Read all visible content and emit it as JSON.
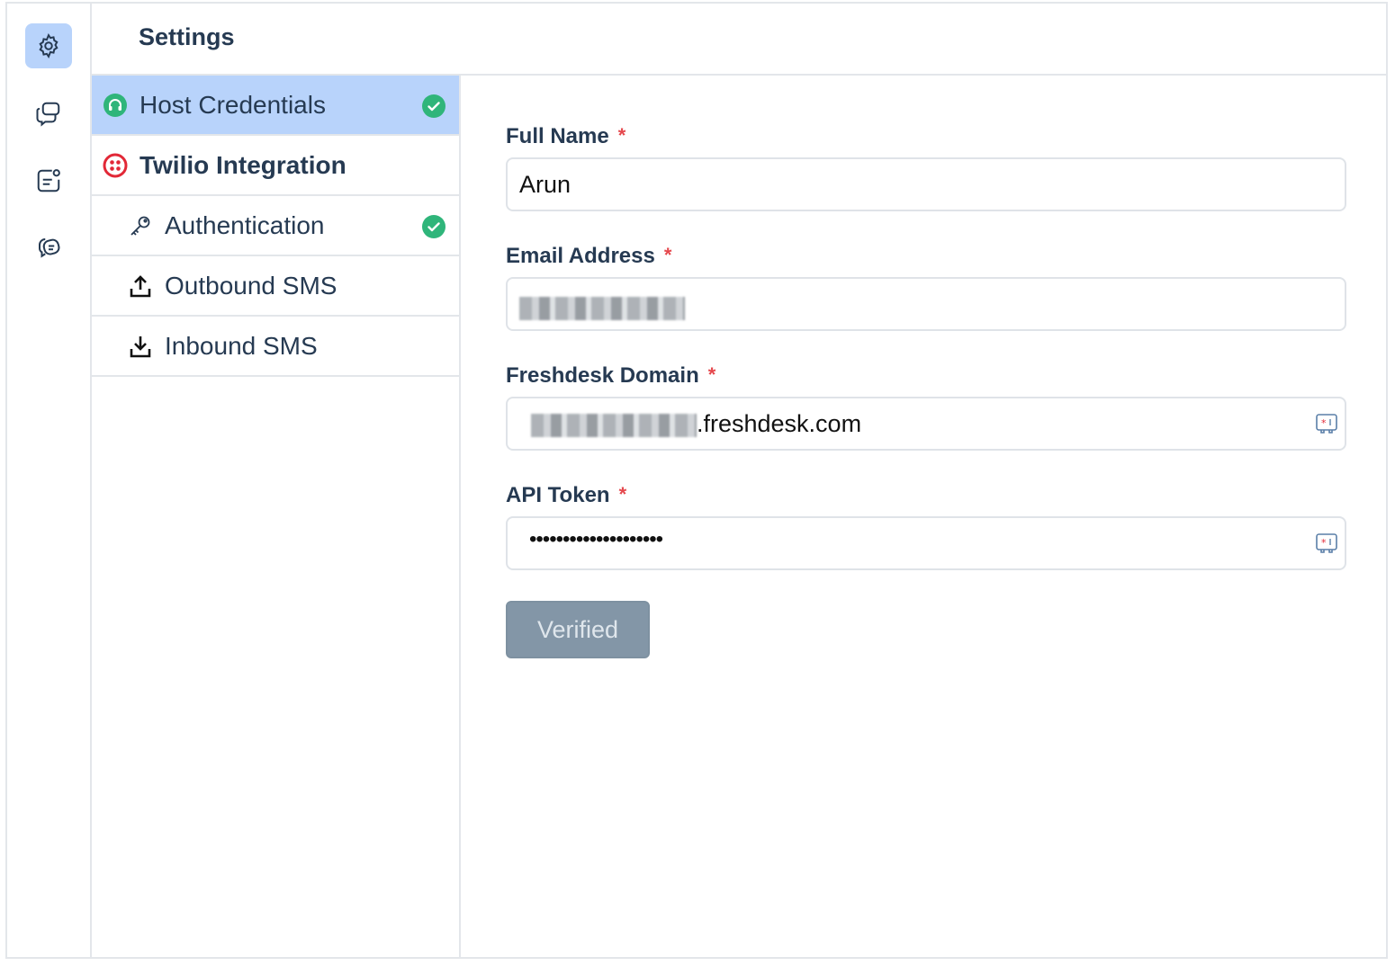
{
  "header": {
    "title": "Settings"
  },
  "rail": {
    "items": [
      {
        "icon": "gear-icon",
        "active": true
      },
      {
        "icon": "chat-bubbles-icon",
        "active": false
      },
      {
        "icon": "contact-card-icon",
        "active": false
      },
      {
        "icon": "brain-chat-icon",
        "active": false
      }
    ]
  },
  "nav": {
    "host_credentials": "Host Credentials",
    "twilio_integration": "Twilio Integration",
    "authentication": "Authentication",
    "outbound_sms": "Outbound SMS",
    "inbound_sms": "Inbound SMS"
  },
  "form": {
    "full_name": {
      "label": "Full Name",
      "value": "Arun"
    },
    "email": {
      "label": "Email Address",
      "value": ""
    },
    "domain": {
      "label": "Freshdesk Domain",
      "suffix": ".freshdesk.com"
    },
    "api_token": {
      "label": "API Token",
      "value": "••••••••••••••••••••"
    },
    "required_mark": "*",
    "verify_button": "Verified"
  },
  "colors": {
    "selected_bg": "#b8d3fb",
    "check_green": "#2fb57a",
    "required_red": "#e5484d",
    "button_bg": "#8396a7"
  }
}
